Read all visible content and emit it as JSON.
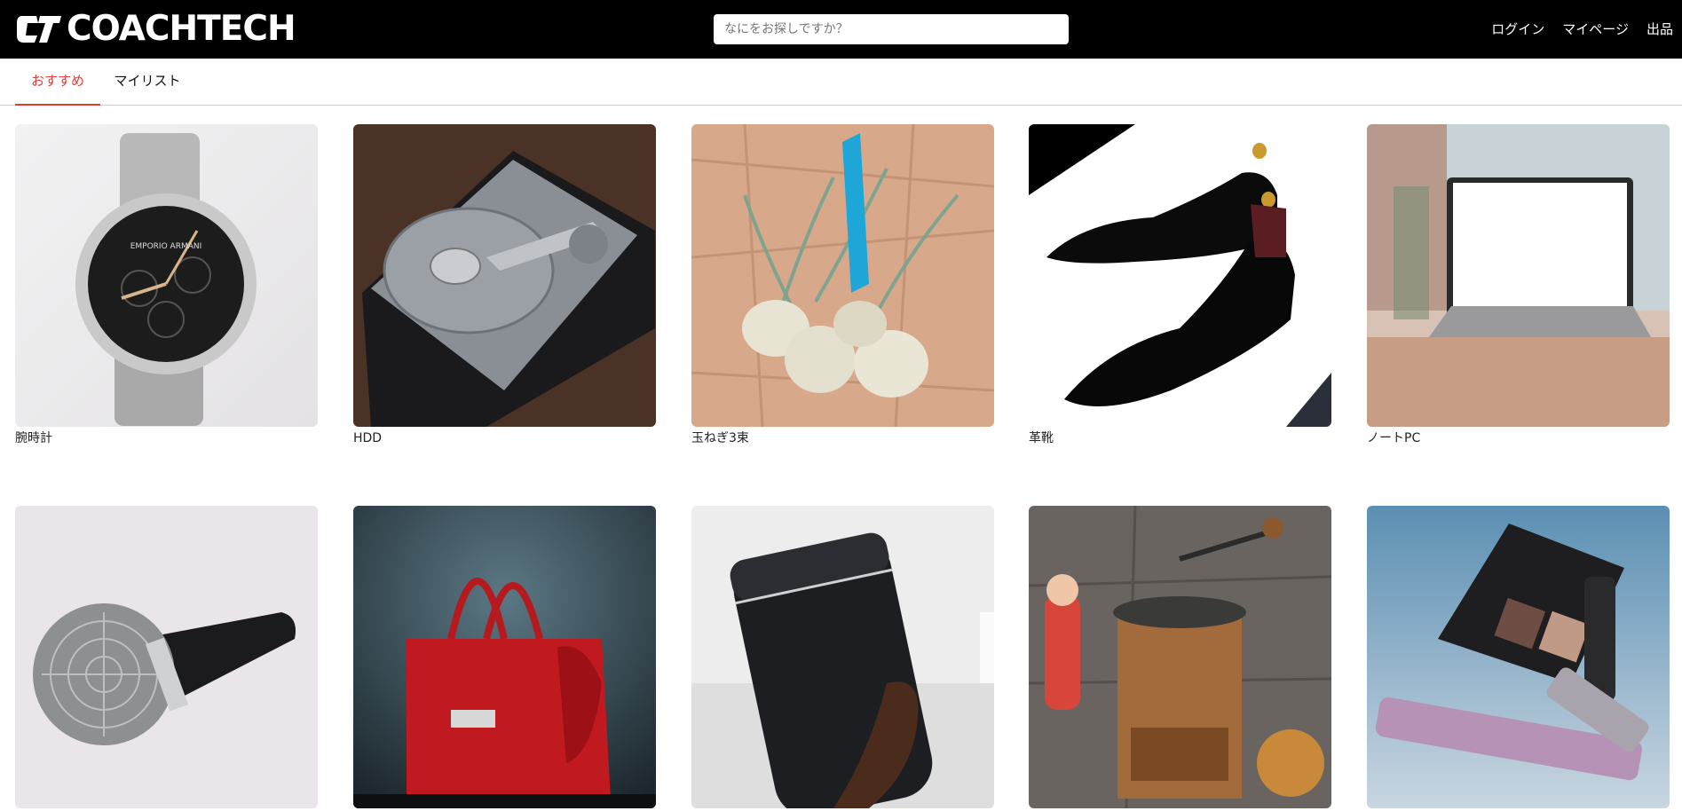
{
  "header": {
    "brand": "COACHTECH",
    "search_placeholder": "なにをお探しですか？",
    "nav": {
      "login": "ログイン",
      "mypage": "マイページ",
      "sell": "出品"
    }
  },
  "tabs": {
    "recommended": "おすすめ",
    "mylist": "マイリスト"
  },
  "colors": {
    "accent": "#e53935",
    "header_bg": "#000000"
  },
  "products": [
    {
      "name": "腕時計",
      "icon": "wristwatch-image"
    },
    {
      "name": "HDD",
      "icon": "hard-disk-image"
    },
    {
      "name": "玉ねぎ3束",
      "icon": "onion-bundle-image"
    },
    {
      "name": "革靴",
      "icon": "leather-shoes-image"
    },
    {
      "name": "ノートPC",
      "icon": "laptop-image"
    },
    {
      "name": "",
      "icon": "microphone-image"
    },
    {
      "name": "",
      "icon": "red-handbag-image"
    },
    {
      "name": "",
      "icon": "tumbler-image"
    },
    {
      "name": "",
      "icon": "coffee-grinder-image"
    },
    {
      "name": "",
      "icon": "makeup-set-image"
    }
  ]
}
